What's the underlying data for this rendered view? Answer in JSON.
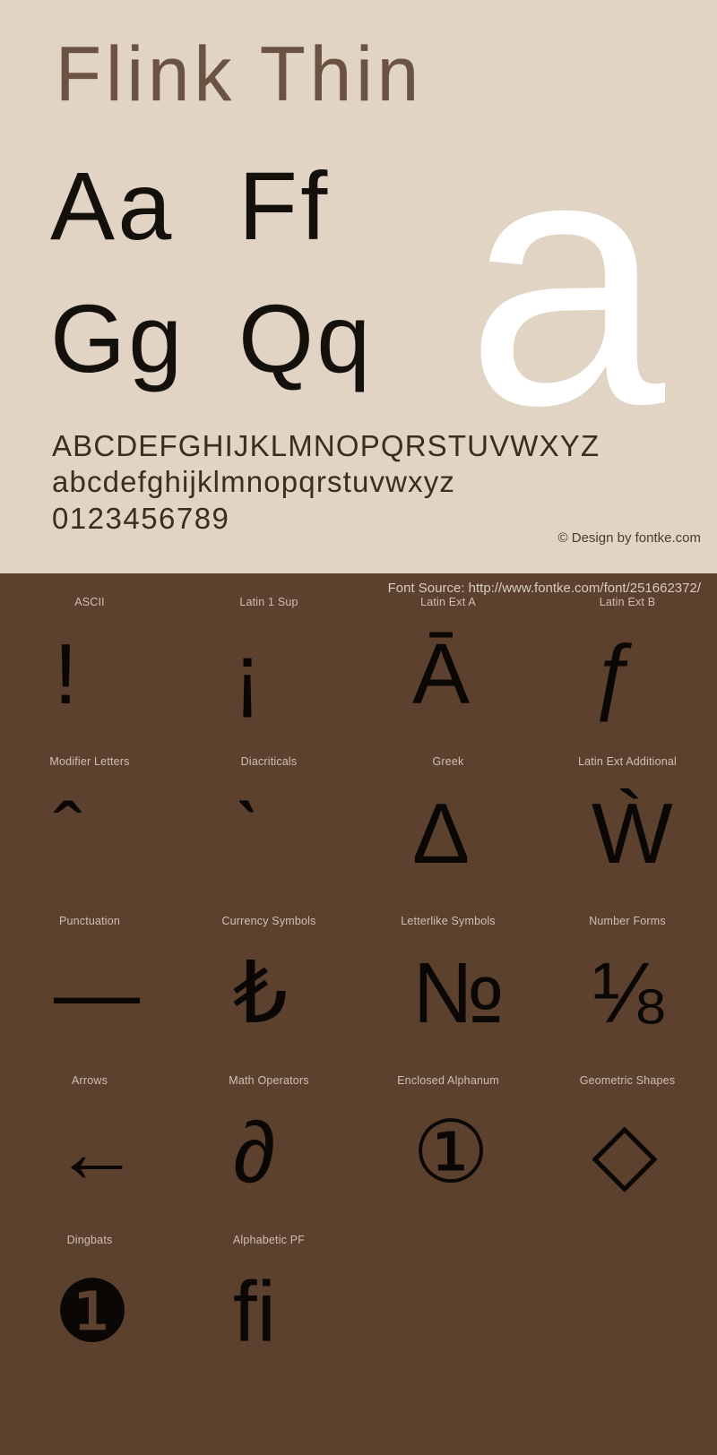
{
  "header": {
    "title": "Flink Thin"
  },
  "hero": {
    "glyph": "a"
  },
  "letter_pairs": [
    {
      "left": "Aa",
      "right": "Ff"
    },
    {
      "left": "Gg",
      "right": "Qq"
    }
  ],
  "alphabet": {
    "uppercase": "ABCDEFGHIJKLMNOPQRSTUVWXYZ",
    "lowercase": "abcdefghijklmnopqrstuvwxyz",
    "digits": "0123456789"
  },
  "credit": "© Design by fontke.com",
  "source": "Font Source: http://www.fontke.com/font/251662372/",
  "unicode_blocks": [
    {
      "label": "ASCII",
      "glyph": "!",
      "size": "normal"
    },
    {
      "label": "Latin 1 Sup",
      "glyph": "¡",
      "size": "normal"
    },
    {
      "label": "Latin Ext A",
      "glyph": "Ā",
      "size": "normal"
    },
    {
      "label": "Latin Ext B",
      "glyph": "ƒ",
      "size": "normal"
    },
    {
      "label": "Modifier Letters",
      "glyph": "ˆ",
      "size": "normal"
    },
    {
      "label": "Diacriticals",
      "glyph": "ˋ",
      "size": "normal"
    },
    {
      "label": "Greek",
      "glyph": "Δ",
      "size": "normal"
    },
    {
      "label": "Latin Ext Additional",
      "glyph": "Ẁ",
      "size": "normal"
    },
    {
      "label": "Punctuation",
      "glyph": "—",
      "size": "normal"
    },
    {
      "label": "Currency Symbols",
      "glyph": "₺",
      "size": "normal"
    },
    {
      "label": "Letterlike Symbols",
      "glyph": "№",
      "size": "normal"
    },
    {
      "label": "Number Forms",
      "glyph": "⅛",
      "size": "normal"
    },
    {
      "label": "Arrows",
      "glyph": "←",
      "size": "normal"
    },
    {
      "label": "Math Operators",
      "glyph": "∂",
      "size": "normal"
    },
    {
      "label": "Enclosed Alphanum",
      "glyph": "①",
      "size": "normal"
    },
    {
      "label": "Geometric Shapes",
      "glyph": "◇",
      "size": "normal"
    },
    {
      "label": "Dingbats",
      "glyph": "❶",
      "size": "normal"
    },
    {
      "label": "Alphabetic PF",
      "glyph": "ﬁ",
      "size": "normal"
    }
  ],
  "colors": {
    "top_background": "#e2d4c4",
    "bottom_background": "#5b412e",
    "title_text": "#6b5343",
    "glyph_dark": "#0a0705",
    "hero_white": "#ffffff",
    "label_text": "#cfc0b1"
  }
}
